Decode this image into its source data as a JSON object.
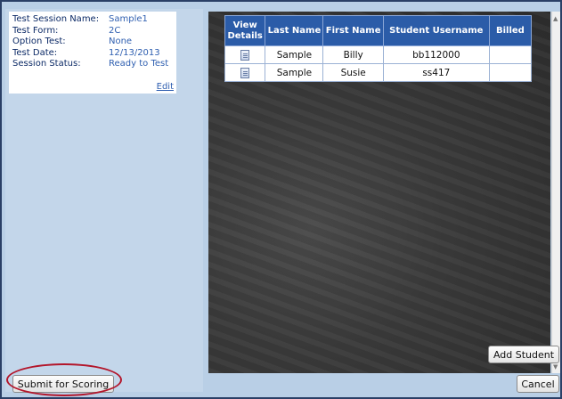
{
  "session": {
    "rows": [
      {
        "label": "Test Session Name:",
        "value": "Sample1"
      },
      {
        "label": "Test Form:",
        "value": "2C"
      },
      {
        "label": "Option Test:",
        "value": "None"
      },
      {
        "label": "Test Date:",
        "value": "12/13/2013"
      },
      {
        "label": "Session Status:",
        "value": "Ready to Test"
      }
    ],
    "edit_label": "Edit"
  },
  "table": {
    "headers": [
      "View Details",
      "Last Name",
      "First Name",
      "Student Username",
      "Billed"
    ],
    "rows": [
      {
        "icon": "document-icon",
        "last": "Sample",
        "first": "Billy",
        "username": "bb112000",
        "billed": ""
      },
      {
        "icon": "document-icon",
        "last": "Sample",
        "first": "Susie",
        "username": "ss417",
        "billed": ""
      }
    ]
  },
  "buttons": {
    "add_student": "Add Student",
    "submit": "Submit for Scoring",
    "cancel": "Cancel"
  },
  "colors": {
    "header_bg": "#2b5ca8",
    "highlight_circle": "#b3162b"
  }
}
